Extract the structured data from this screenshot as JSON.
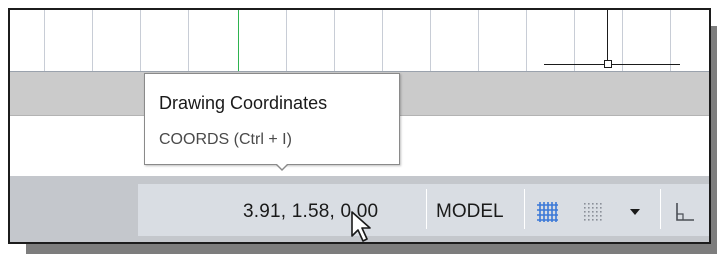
{
  "status_bar": {
    "coordinates": "3.91, 1.58, 0.00",
    "space_label": "MODEL",
    "icons": [
      "grid-icon",
      "snap-icon",
      "chevron-down-icon",
      "ortho-icon"
    ]
  },
  "tooltip": {
    "title": "Drawing Coordinates",
    "command": "COORDS (Ctrl + I)"
  },
  "colors": {
    "grid_active": "#3a78d8",
    "y_axis_gridline": "#2eb34f",
    "status_bar_bg": "#d9dde3"
  }
}
